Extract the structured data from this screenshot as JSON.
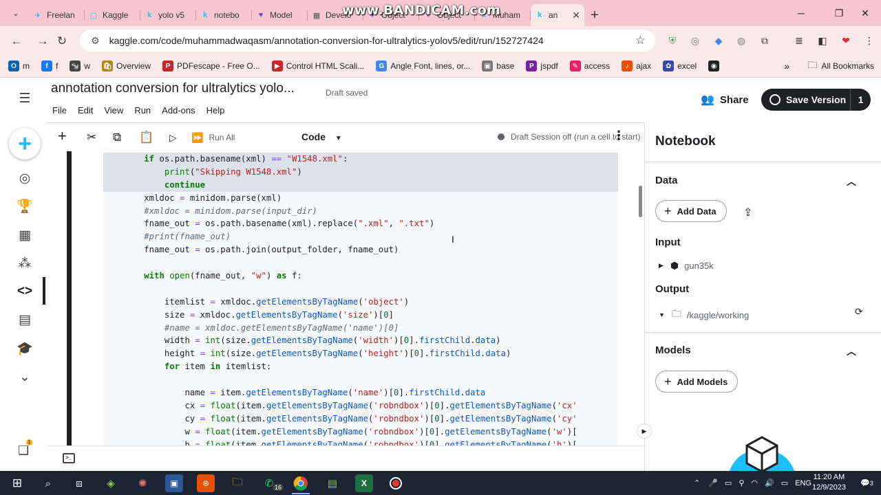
{
  "browser": {
    "tabs": [
      {
        "label": "Freelan",
        "icon": "freelancer-icon",
        "color": "#29b2fe",
        "glyph": "✈"
      },
      {
        "label": "Kaggle",
        "icon": "kaggle-icon",
        "color": "#20beff",
        "glyph": "▢"
      },
      {
        "label": "yolo v5",
        "icon": "kaggle-k-icon",
        "color": "#20beff",
        "glyph": "k"
      },
      {
        "label": "notebo",
        "icon": "kaggle-k-icon",
        "color": "#20beff",
        "glyph": "k"
      },
      {
        "label": "Model",
        "icon": "roboflow-icon",
        "color": "#6a3de8",
        "glyph": "♥"
      },
      {
        "label": "Develo",
        "icon": "developer-icon",
        "color": "#555",
        "glyph": "▦"
      },
      {
        "label": "Object",
        "icon": "roboflow-icon",
        "color": "#6a3de8",
        "glyph": "♥"
      },
      {
        "label": "Object",
        "icon": "roboflow-icon",
        "color": "#6a3de8",
        "glyph": "♥"
      },
      {
        "label": "Muham",
        "icon": "kaggle-k-icon",
        "color": "#20beff",
        "glyph": "k"
      },
      {
        "label": "an",
        "icon": "kaggle-k-icon",
        "color": "#20beff",
        "glyph": "k"
      }
    ],
    "watermark": "www.BANDICAM.com",
    "url": "kaggle.com/code/muhammadwaqasm/annotation-conversion-for-ultralytics-yolov5/edit/run/152727424",
    "bookmarks": [
      {
        "label": "m",
        "color": "#0364b8",
        "glyph": "O"
      },
      {
        "label": "f",
        "color": "#1877f2",
        "glyph": "f"
      },
      {
        "label": "w",
        "color": "#444",
        "glyph": "🐄"
      },
      {
        "label": "Overview",
        "color": "#b3861d",
        "glyph": "🛍"
      },
      {
        "label": "PDFescape - Free O...",
        "color": "#c62828",
        "glyph": "P"
      },
      {
        "label": "Control HTML Scali...",
        "color": "#c62828",
        "glyph": "▶"
      },
      {
        "label": "Angle Font, lines, or...",
        "color": "#4285f4",
        "glyph": "G"
      },
      {
        "label": "base",
        "color": "#777",
        "glyph": "▣"
      },
      {
        "label": "jspdf",
        "color": "#7b1fa2",
        "glyph": "P"
      },
      {
        "label": "access",
        "color": "#e91e63",
        "glyph": "✎"
      },
      {
        "label": "ajax",
        "color": "#e65100",
        "glyph": "♪"
      },
      {
        "label": "excel",
        "color": "#3949ab",
        "glyph": "✿"
      },
      {
        "label": "",
        "color": "#222",
        "glyph": "◉"
      }
    ],
    "all_bookmarks": "All Bookmarks"
  },
  "kaggle": {
    "title": "annotation conversion for ultralytics yolo...",
    "draft_status": "Draft saved",
    "menu": [
      "File",
      "Edit",
      "View",
      "Run",
      "Add-ons",
      "Help"
    ],
    "share": "Share",
    "save_version": "Save Version",
    "version_count": "1",
    "toolbar": {
      "run_all": "Run All",
      "cell_type": "Code",
      "session": "Draft Session off (run a cell to start)"
    }
  },
  "code_lines": [
    {
      "sel": true,
      "html": "        <span class='kw'>if</span> os.path.basename(xml) <span class='op'>==</span> <span class='st'>\"W1548.xml\"</span>:"
    },
    {
      "sel": true,
      "html": "            <span class='bi2'>print</span>(<span class='st'>\"Skipping W1548.xml\"</span>)"
    },
    {
      "sel": true,
      "html": "            <span class='kw'>continue</span>"
    },
    {
      "sel": false,
      "html": "        xmldoc <span class='op'>=</span> minidom.parse(xml)"
    },
    {
      "sel": false,
      "html": "        <span class='cm'>#xmldoc = minidom.parse(input_dir)</span>"
    },
    {
      "sel": false,
      "html": "        fname_out <span class='op'>=</span> os.path.basename(xml).replace(<span class='st'>\".xml\"</span>, <span class='st'>\".txt\"</span>)"
    },
    {
      "sel": false,
      "html": "        <span class='cm'>#print(fname_out)</span>"
    },
    {
      "sel": false,
      "html": "        fname_out <span class='op'>=</span> os.path.join(output_folder, fname_out)"
    },
    {
      "sel": false,
      "html": ""
    },
    {
      "sel": false,
      "html": "        <span class='kw'>with</span> <span class='bi2'>open</span>(fname_out, <span class='st'>\"w\"</span>) <span class='kw'>as</span> f:"
    },
    {
      "sel": false,
      "html": ""
    },
    {
      "sel": false,
      "html": "            itemlist <span class='op'>=</span> xmldoc.<span class='fn'>getElementsByTagName</span>(<span class='st'>'object'</span>)"
    },
    {
      "sel": false,
      "html": "            size <span class='op'>=</span> xmldoc.<span class='fn'>getElementsByTagName</span>(<span class='st'>'size'</span>)[<span class='nm'>0</span>]"
    },
    {
      "sel": false,
      "html": "            <span class='cm'>#name = xmldoc.getElementsByTagName('name')[0]</span>"
    },
    {
      "sel": false,
      "html": "            width <span class='op'>=</span> <span class='bi2'>int</span>(size.<span class='fn'>getElementsByTagName</span>(<span class='st'>'width'</span>)[<span class='nm'>0</span>].<span class='fn'>firstChild</span>.<span class='fn'>data</span>)"
    },
    {
      "sel": false,
      "html": "            height <span class='op'>=</span> <span class='bi2'>int</span>(size.<span class='fn'>getElementsByTagName</span>(<span class='st'>'height'</span>)[<span class='nm'>0</span>].<span class='fn'>firstChild</span>.<span class='fn'>data</span>)"
    },
    {
      "sel": false,
      "html": "            <span class='kw'>for</span> item <span class='kw'>in</span> itemlist:"
    },
    {
      "sel": false,
      "html": ""
    },
    {
      "sel": false,
      "html": "                name <span class='op'>=</span> item.<span class='fn'>getElementsByTagName</span>(<span class='st'>'name'</span>)[<span class='nm'>0</span>].<span class='fn'>firstChild</span>.<span class='fn'>data</span>"
    },
    {
      "sel": false,
      "html": "                cx <span class='op'>=</span> <span class='bi2'>float</span>(item.<span class='fn'>getElementsByTagName</span>(<span class='st'>'robndbox'</span>)[<span class='nm'>0</span>].<span class='fn'>getElementsByTagName</span>(<span class='st'>'cx'</span>"
    },
    {
      "sel": false,
      "html": "                cy <span class='op'>=</span> <span class='bi2'>float</span>(item.<span class='fn'>getElementsByTagName</span>(<span class='st'>'robndbox'</span>)[<span class='nm'>0</span>].<span class='fn'>getElementsByTagName</span>(<span class='st'>'cy'</span>"
    },
    {
      "sel": false,
      "html": "                w <span class='op'>=</span> <span class='bi2'>float</span>(item.<span class='fn'>getElementsByTagName</span>(<span class='st'>'robndbox'</span>)[<span class='nm'>0</span>].<span class='fn'>getElementsByTagName</span>(<span class='st'>'w'</span>)["
    },
    {
      "sel": false,
      "html": "                h <span class='op'>=</span> <span class='bi2'>float</span>(item.<span class='fn'>getElementsByTagName</span>(<span class='st'>'robndbox'</span>)[<span class='nm'>0</span>].<span class='fn'>getElementsByTagName</span>(<span class='st'>'h'</span>)["
    }
  ],
  "panel": {
    "title": "Notebook",
    "data_section": "Data",
    "add_data": "Add Data",
    "input_label": "Input",
    "input_item": "gun35k",
    "output_label": "Output",
    "output_item": "/kaggle/working",
    "models_section": "Models",
    "add_models": "Add Models"
  },
  "taskbar": {
    "whatsapp_badge": "16",
    "lang": "ENG",
    "time": "11:20 AM",
    "date": "12/9/2023",
    "notif_count": "3"
  },
  "kaggle_badge_count": "1"
}
